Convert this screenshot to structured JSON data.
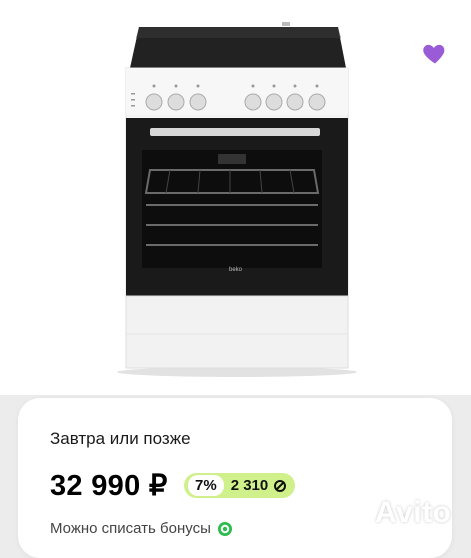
{
  "listing": {
    "delivery": "Завтра или позже",
    "price": "32 990 ₽",
    "cashback_percent": "7%",
    "cashback_amount": "2 310",
    "bonus_text": "Можно списать бонусы",
    "product_brand": "beko",
    "favorited": true
  },
  "watermark": {
    "text": "Avito"
  },
  "colors": {
    "favorite": "#9a5bd6",
    "cashback_pill": "#cff08a",
    "bonus_icon": "#2dbd4e"
  },
  "icons": [
    "heart-icon",
    "coin-icon",
    "bonus-icon",
    "avito-logo-icon"
  ]
}
